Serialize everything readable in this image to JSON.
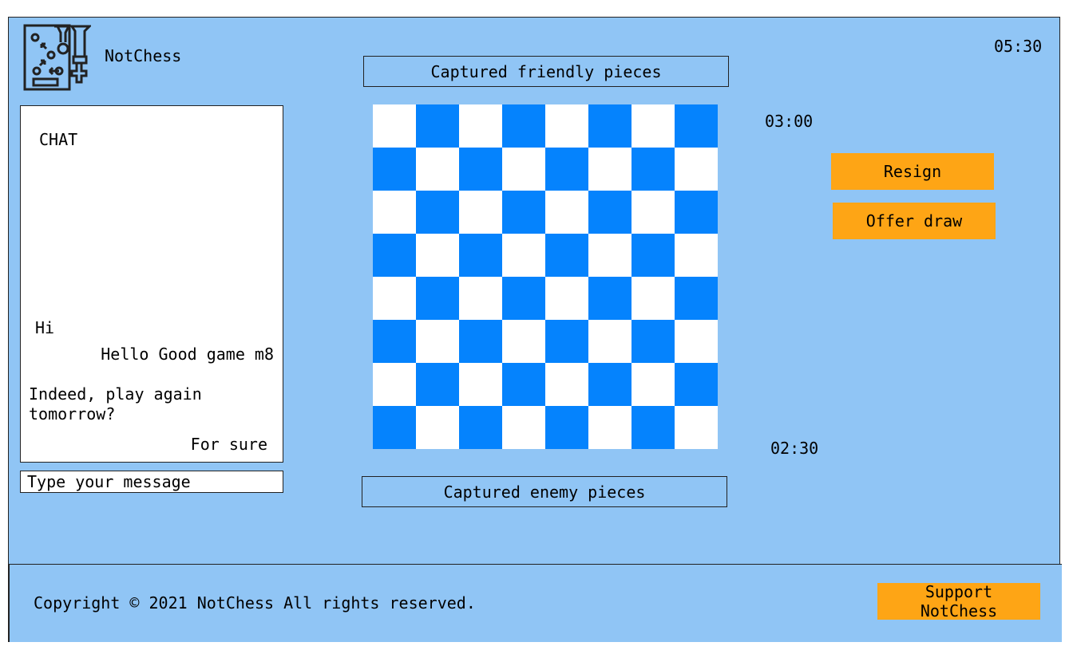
{
  "header": {
    "brand": "NotChess",
    "game_timer": "05:30"
  },
  "chat": {
    "title": "CHAT",
    "messages": [
      {
        "text": "Hi",
        "side": "left"
      },
      {
        "text": "Hello Good game m8",
        "side": "right"
      },
      {
        "text": "Indeed, play again tomorrow?",
        "side": "left"
      },
      {
        "text": "For sure",
        "side": "right"
      }
    ],
    "input_placeholder": "Type your message"
  },
  "board": {
    "captured_friendly_label": "Captured friendly pieces",
    "captured_enemy_label": "Captured enemy pieces",
    "light_color": "#ffffff",
    "dark_color": "#0583fd",
    "opponent_timer": "03:00",
    "player_timer": "02:30"
  },
  "actions": {
    "resign_label": "Resign",
    "offer_draw_label": "Offer draw",
    "button_color": "#fea515"
  },
  "footer": {
    "copyright": "Copyright © 2021 NotChess All rights reserved.",
    "support_label": "Support NotChess"
  },
  "icons": {
    "logo": "chess-strategy-logo-icon"
  }
}
